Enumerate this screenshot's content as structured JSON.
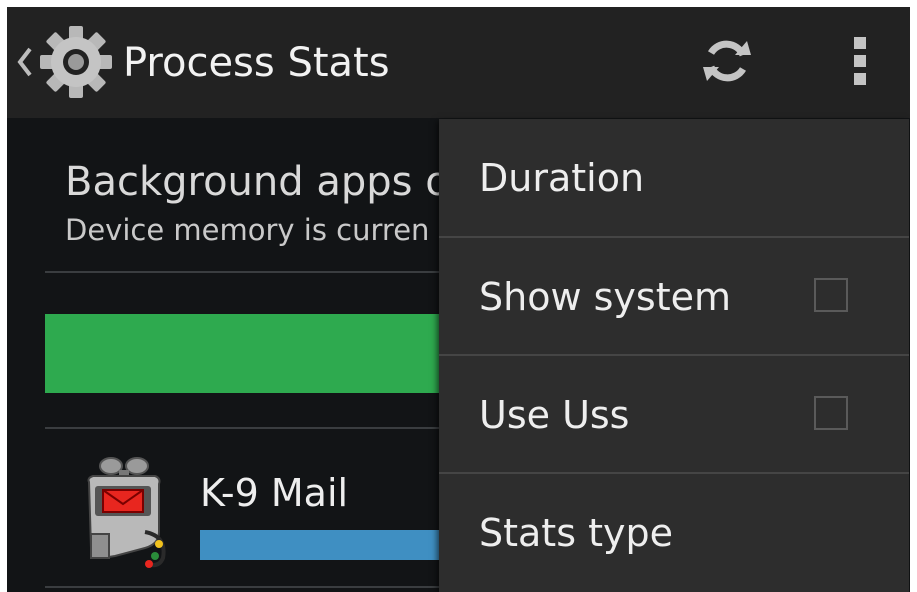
{
  "action_bar": {
    "title": "Process Stats",
    "up_icon": "chevron-left-icon",
    "app_icon": "settings-gear-icon",
    "refresh_icon": "refresh-icon",
    "overflow_icon": "overflow-menu-icon"
  },
  "content": {
    "heading": "Background apps ov",
    "subheading": "Device memory is curren",
    "memory_bar_color": "#2eaa4f",
    "apps": [
      {
        "name": "K-9 Mail",
        "icon": "k9-mail-icon",
        "bar_color": "#3f8fc2"
      }
    ]
  },
  "menu": {
    "items": [
      {
        "label": "Duration",
        "has_checkbox": false
      },
      {
        "label": "Show system",
        "has_checkbox": true,
        "checked": false
      },
      {
        "label": "Use Uss",
        "has_checkbox": true,
        "checked": false
      },
      {
        "label": "Stats type",
        "has_checkbox": false
      }
    ]
  },
  "colors": {
    "action_bar_bg": "#222222",
    "screen_bg": "#121416",
    "menu_bg": "#2d2d2d"
  }
}
